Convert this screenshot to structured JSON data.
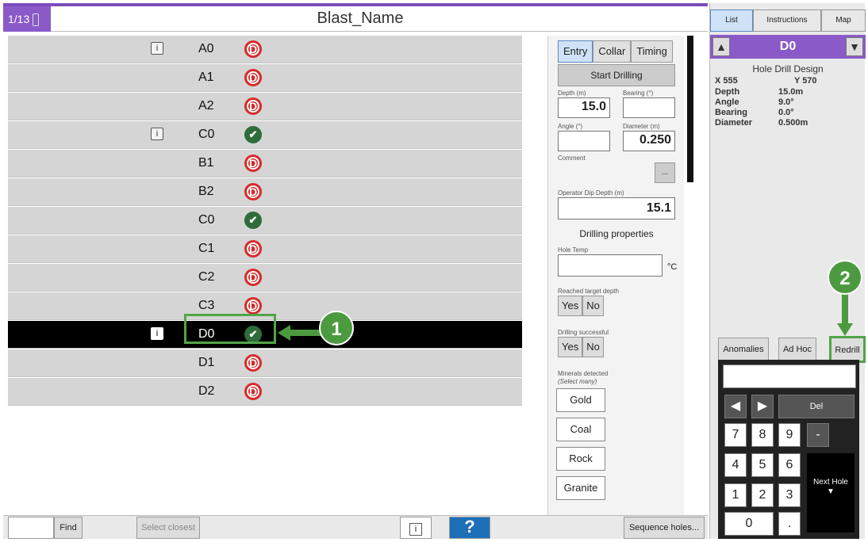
{
  "header": {
    "counter": "1/13",
    "title": "Blast_Name"
  },
  "holes": [
    {
      "name": "A0",
      "info": true,
      "status": "D",
      "status_kind": "d"
    },
    {
      "name": "A1",
      "info": false,
      "status": "D",
      "status_kind": "d"
    },
    {
      "name": "A2",
      "info": false,
      "status": "D",
      "status_kind": "d"
    },
    {
      "name": "C0",
      "info": true,
      "status": "✔",
      "status_kind": "ok"
    },
    {
      "name": "B1",
      "info": false,
      "status": "D",
      "status_kind": "d"
    },
    {
      "name": "B2",
      "info": false,
      "status": "D",
      "status_kind": "d"
    },
    {
      "name": "C0",
      "info": false,
      "status": "✔",
      "status_kind": "ok"
    },
    {
      "name": "C1",
      "info": false,
      "status": "D",
      "status_kind": "d"
    },
    {
      "name": "C2",
      "info": false,
      "status": "D",
      "status_kind": "d"
    },
    {
      "name": "C3",
      "info": false,
      "status": "D",
      "status_kind": "d"
    },
    {
      "name": "D0",
      "info": true,
      "status": "✔",
      "status_kind": "ok",
      "selected": true
    },
    {
      "name": "D1",
      "info": false,
      "status": "D",
      "status_kind": "d"
    },
    {
      "name": "D2",
      "info": false,
      "status": "D",
      "status_kind": "d"
    }
  ],
  "info_glyph": "i",
  "callouts": {
    "one": "1",
    "two": "2"
  },
  "entry": {
    "tabs": [
      "Entry",
      "Collar",
      "Timing"
    ],
    "start_drilling": "Start Drilling",
    "depth_label": "Depth (m)",
    "depth_value": "15.0",
    "bearing_label": "Bearing (°)",
    "bearing_value": "",
    "angle_label": "Angle (°)",
    "angle_value": "",
    "diameter_label": "Diameter (m)",
    "diameter_value": "0.250",
    "comment_label": "Comment",
    "comment_button": "...",
    "dip_label": "Operator Dip Depth (m)",
    "dip_value": "15.1",
    "drilling_properties": "Drilling properties",
    "hole_temp_label": "Hole Temp",
    "hole_temp_unit": "°C",
    "reached_label": "Reached target depth",
    "success_label": "Drilling successful",
    "yes": "Yes",
    "no": "No",
    "minerals_label": "Minerals detected",
    "minerals_hint": "(Select many)",
    "minerals": [
      "Gold",
      "Coal",
      "Rock",
      "Granite"
    ]
  },
  "right": {
    "tabs": [
      "List",
      "Instructions",
      "Map"
    ],
    "hole": "D0",
    "design_title": "Hole Drill Design",
    "x": "X 555",
    "y": "Y 570",
    "rows": [
      {
        "k": "Depth",
        "v": "15.0m"
      },
      {
        "k": "Angle",
        "v": "9.0°"
      },
      {
        "k": "Bearing",
        "v": "0.0°"
      },
      {
        "k": "Diameter",
        "v": "0.500m"
      }
    ],
    "anomalies": "Anomalies",
    "adhoc": "Ad Hoc",
    "redrill": "Redrill",
    "keys": {
      "k7": "7",
      "k8": "8",
      "k9": "9",
      "minus": "-",
      "k4": "4",
      "k5": "5",
      "k6": "6",
      "k1": "1",
      "k2": "2",
      "k3": "3",
      "k0": "0",
      "dot": ".",
      "del": "Del",
      "left": "◀",
      "right": "▶",
      "next": "Next Hole"
    }
  },
  "bottom": {
    "find": "Find",
    "select_closest": "Select closest",
    "help": "?",
    "sequence": "Sequence holes..."
  },
  "colors": {
    "accent": "#8a5ac8",
    "callout": "#4c9a3f",
    "danger": "#d62a2a",
    "ok": "#2e6d3a"
  }
}
